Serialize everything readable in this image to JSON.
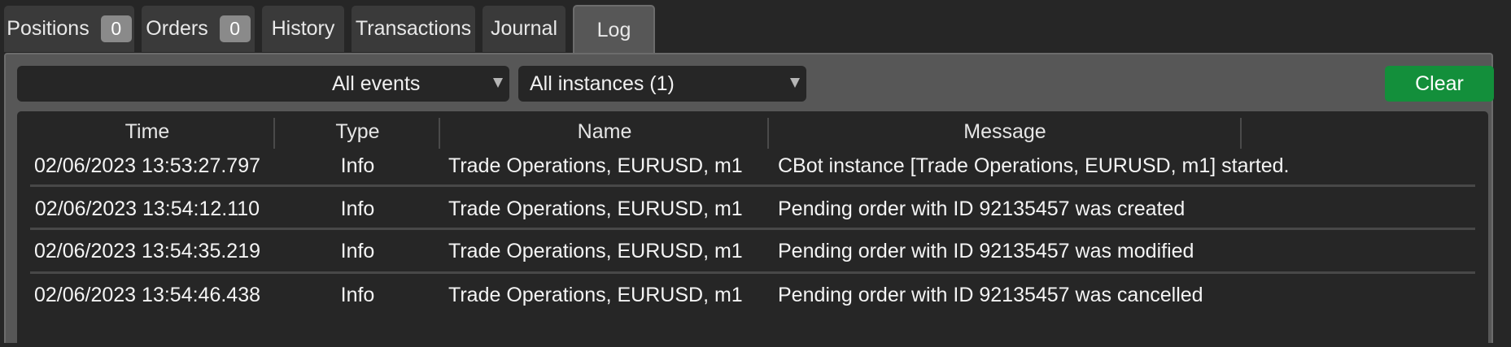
{
  "tabs": [
    {
      "label": "Positions",
      "badge": "0"
    },
    {
      "label": "Orders",
      "badge": "0"
    },
    {
      "label": "History"
    },
    {
      "label": "Transactions"
    },
    {
      "label": "Journal"
    },
    {
      "label": "Log"
    }
  ],
  "active_tab": "Log",
  "toolbar": {
    "search_value": "",
    "events_filter": "All events",
    "instances_filter": "All instances (1)",
    "clear_label": "Clear"
  },
  "table": {
    "columns": [
      "Time",
      "Type",
      "Name",
      "Message"
    ],
    "rows": [
      {
        "time": "02/06/2023 13:53:27.797",
        "type": "Info",
        "name": "Trade Operations, EURUSD, m1",
        "message": "CBot instance [Trade Operations, EURUSD, m1] started."
      },
      {
        "time": "02/06/2023 13:54:12.110",
        "type": "Info",
        "name": "Trade Operations, EURUSD, m1",
        "message": "Pending order with ID 92135457 was created"
      },
      {
        "time": "02/06/2023 13:54:35.219",
        "type": "Info",
        "name": "Trade Operations, EURUSD, m1",
        "message": "Pending order with ID 92135457 was modified"
      },
      {
        "time": "02/06/2023 13:54:46.438",
        "type": "Info",
        "name": "Trade Operations, EURUSD, m1",
        "message": "Pending order with ID 92135457 was cancelled"
      }
    ]
  },
  "colors": {
    "accent_green": "#138f3b",
    "background": "#262626",
    "panel": "#575757"
  },
  "icons": {
    "search": "magnifier-icon",
    "dropdown": "chevron-down-icon"
  }
}
